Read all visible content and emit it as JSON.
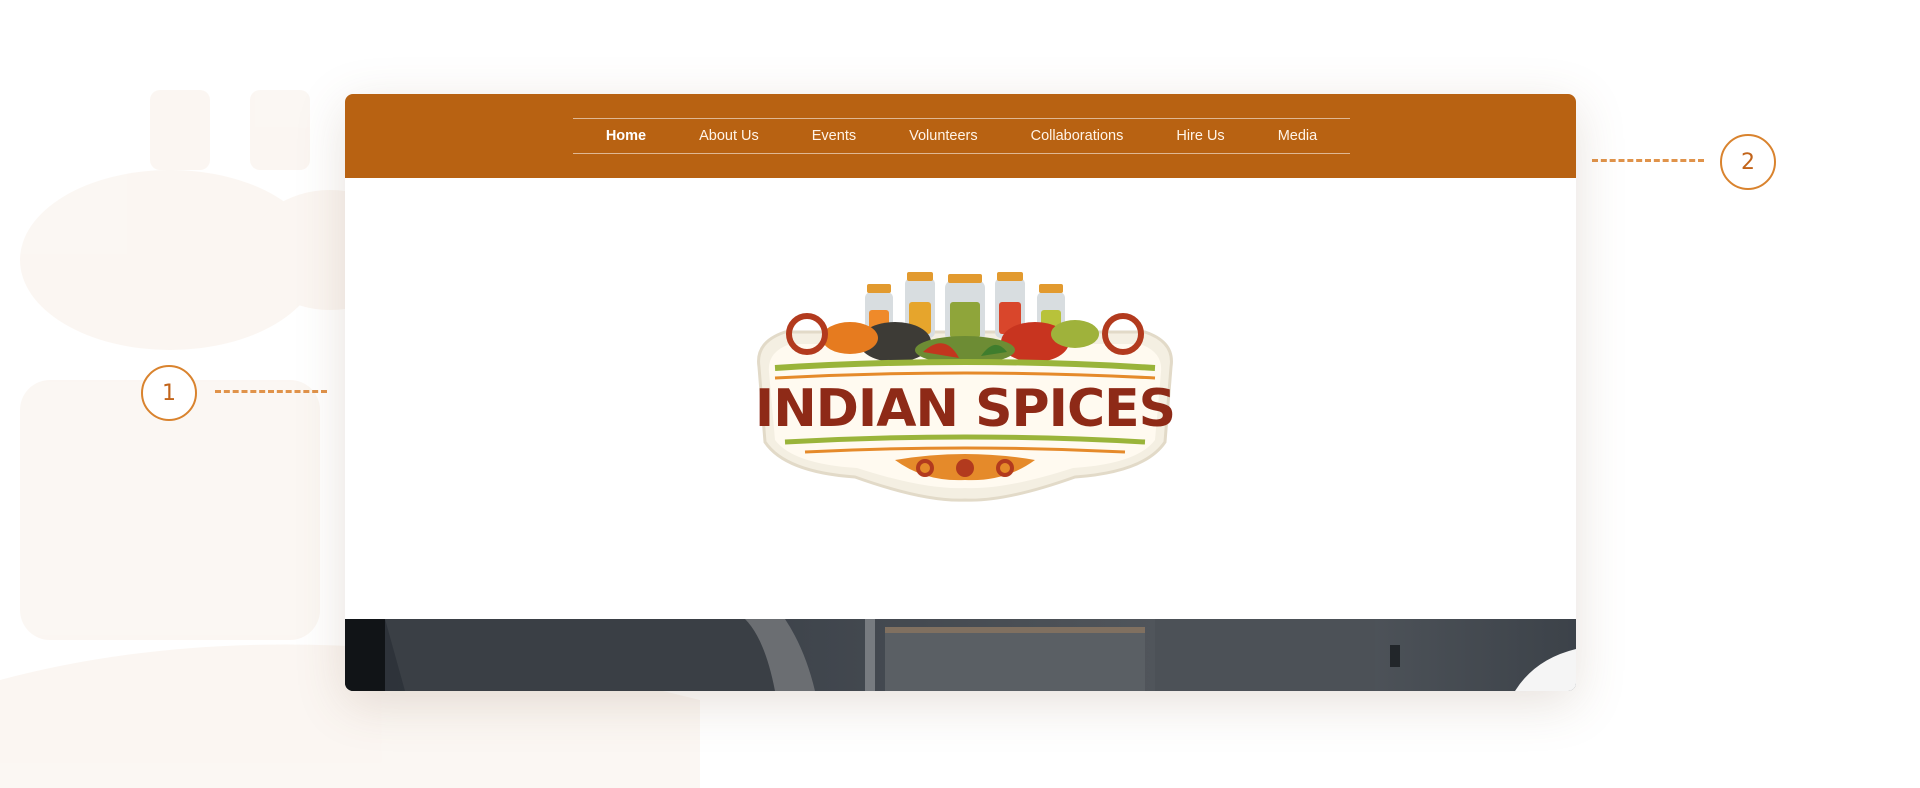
{
  "nav": {
    "items": [
      {
        "label": "Home",
        "active": true
      },
      {
        "label": "About Us",
        "active": false
      },
      {
        "label": "Events",
        "active": false
      },
      {
        "label": "Volunteers",
        "active": false
      },
      {
        "label": "Collaborations",
        "active": false
      },
      {
        "label": "Hire Us",
        "active": false
      },
      {
        "label": "Media",
        "active": false
      }
    ]
  },
  "logo": {
    "text": "INDIAN SPICES"
  },
  "callouts": {
    "one": "1",
    "two": "2"
  },
  "colors": {
    "accent": "#b86212",
    "callout": "#d9832e",
    "logo_red": "#8e2a17"
  }
}
